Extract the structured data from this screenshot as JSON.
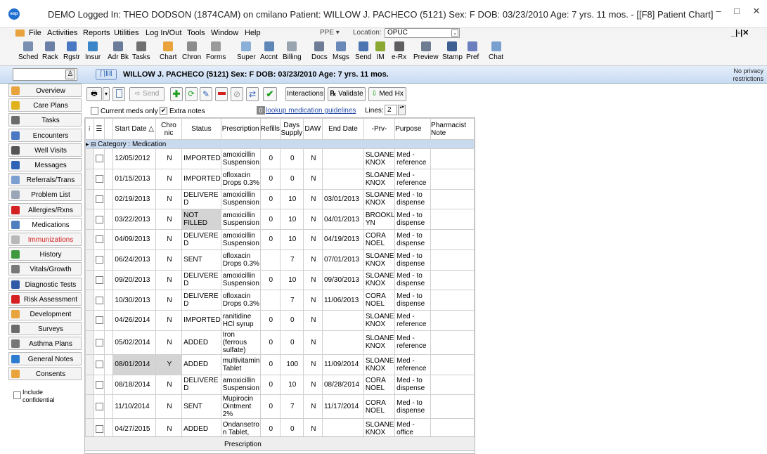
{
  "window": {
    "title": "DEMO Logged In: THEO DODSON (1874CAM) on cmilano  Patient: WILLOW J. PACHECO (5121)  Sex: F  DOB: 03/23/2010  Age: 7 yrs. 11 mos. - [[F8] Patient Chart]",
    "logo": "eop",
    "min": "–",
    "max": "□",
    "close": "✕"
  },
  "menu": {
    "items": [
      "File",
      "Activities",
      "Reports",
      "Utilities",
      "Log In/Out",
      "Tools",
      "Window",
      "Help"
    ],
    "ppe": "PPE ▾",
    "location_label": "Location:",
    "location_value": "OPUC",
    "location_dd": "⌄",
    "mdi": "_|▫|✕"
  },
  "toolbar": [
    {
      "label": "Sched",
      "icon": "calendar-icon",
      "color": "#7a8fb0"
    },
    {
      "label": "Rack",
      "icon": "rack-icon",
      "color": "#6c7fa6"
    },
    {
      "label": "Rgstr",
      "icon": "register-icon",
      "color": "#4a78c2"
    },
    {
      "label": "Insur",
      "icon": "insurance-icon",
      "color": "#3b86c9"
    },
    {
      "label": "Adr Bk",
      "icon": "address-book-icon",
      "color": "#6a7c98"
    },
    {
      "label": "Tasks",
      "icon": "tasks-icon",
      "color": "#707070"
    },
    {
      "label": "Chart",
      "icon": "chart-folder-icon",
      "color": "#e8a33c"
    },
    {
      "label": "Chron",
      "icon": "chronology-icon",
      "color": "#8b8b8b"
    },
    {
      "label": "Forms",
      "icon": "forms-icon",
      "color": "#9a9a9a"
    },
    {
      "label": "Super",
      "icon": "superbill-icon",
      "color": "#8ab0d8"
    },
    {
      "label": "Accnt",
      "icon": "account-icon",
      "color": "#5e86b7"
    },
    {
      "label": "Billing",
      "icon": "billing-icon",
      "color": "#9aa3b0"
    },
    {
      "label": "Docs",
      "icon": "docs-icon",
      "color": "#6e7d95"
    },
    {
      "label": "Msgs",
      "icon": "messages-icon",
      "color": "#6a88b8"
    },
    {
      "label": "Send",
      "icon": "send-icon",
      "color": "#4b74b2"
    },
    {
      "label": "IM",
      "icon": "instant-message-icon",
      "color": "#8aa832"
    },
    {
      "label": "e-Rx",
      "icon": "erx-icon",
      "color": "#5f5f5f"
    },
    {
      "label": "Preview",
      "icon": "preview-icon",
      "color": "#6d7c90"
    },
    {
      "label": "Stamp",
      "icon": "stamp-icon",
      "color": "#3f5f93"
    },
    {
      "label": "Pref",
      "icon": "preferences-icon",
      "color": "#6b7fbf"
    },
    {
      "label": "Chat",
      "icon": "chat-icon",
      "color": "#7aa0d0"
    }
  ],
  "patient": {
    "banner": "WILLOW J. PACHECO (5121)  Sex: F  DOB: 03/23/2010  Age: 7 yrs. 11 mos.",
    "privacy": "No privacy restrictions",
    "icon_text": "⌈⌉ⅡⅡ"
  },
  "sidebar": [
    {
      "label": "Overview",
      "icon": "overview-icon",
      "color": "#e8a33c"
    },
    {
      "label": "Care Plans",
      "icon": "care-plans-icon",
      "color": "#e0b21e"
    },
    {
      "label": "Tasks",
      "icon": "tasks-icon",
      "color": "#6b6b6b"
    },
    {
      "label": "Encounters",
      "icon": "encounters-icon",
      "color": "#4a78c2"
    },
    {
      "label": "Well Visits",
      "icon": "stethoscope-icon",
      "color": "#555555"
    },
    {
      "label": "Messages",
      "icon": "messages-icon",
      "color": "#2e63b5"
    },
    {
      "label": "Referrals/Trans",
      "icon": "referrals-icon",
      "color": "#7a9fd0"
    },
    {
      "label": "Problem List",
      "icon": "problem-list-icon",
      "color": "#9aa6b5"
    },
    {
      "label": "Allergies/Rxns",
      "icon": "allergies-icon",
      "color": "#d42020"
    },
    {
      "label": "Medications",
      "icon": "medications-icon",
      "color": "#4f7fbe"
    },
    {
      "label": "Immunizations",
      "icon": "syringe-icon",
      "color": "#b8b8b8"
    },
    {
      "label": "History",
      "icon": "history-icon",
      "color": "#3f9a3f"
    },
    {
      "label": "Vitals/Growth",
      "icon": "vitals-icon",
      "color": "#777777"
    },
    {
      "label": "Diagnostic Tests",
      "icon": "diagnostic-icon",
      "color": "#2e5aa8"
    },
    {
      "label": "Risk Assessment",
      "icon": "risk-icon",
      "color": "#d42020"
    },
    {
      "label": "Development",
      "icon": "development-icon",
      "color": "#e8a33c"
    },
    {
      "label": "Surveys",
      "icon": "surveys-icon",
      "color": "#6b6b6b"
    },
    {
      "label": "Asthma Plans",
      "icon": "asthma-icon",
      "color": "#777777"
    },
    {
      "label": "General Notes",
      "icon": "general-notes-icon",
      "color": "#2c7bd0"
    },
    {
      "label": "Consents",
      "icon": "consents-icon",
      "color": "#e8a33c"
    }
  ],
  "include_confidential": "Include confidential",
  "medtb": {
    "send": "Send",
    "interactions": "Interactions",
    "validate": "Validate",
    "medhx": "Med Hx",
    "print_glyph": "🖶",
    "add_glyph": "✚",
    "dd": "▾",
    "rx": "℞",
    "check": "✔"
  },
  "opts": {
    "current_meds": "Current meds only",
    "extra_notes": "Extra notes",
    "guide_count": "0",
    "guide_link": "lookup medication guidelines",
    "lines_label": "Lines:",
    "lines_value": "2",
    "check": "✔",
    "spin": "▴▾"
  },
  "grid": {
    "columns": [
      "",
      "",
      "",
      "Start Date △",
      "Chro nic",
      "Status",
      "Prescription",
      "Refills",
      "Days Supply",
      "DAW",
      "End Date",
      "-Prv-",
      "Purpose",
      "Pharmacist Note"
    ],
    "category": "Category : Medication",
    "rows": [
      [
        "12/05/2012",
        "N",
        "IMPORTED",
        "amoxicillin Suspension",
        "0",
        "0",
        "N",
        "",
        "SLOANE KNOX",
        "Med - reference",
        ""
      ],
      [
        "01/15/2013",
        "N",
        "IMPORTED",
        "ofloxacin Drops 0.3%",
        "0",
        "0",
        "N",
        "",
        "SLOANE KNOX",
        "Med - reference",
        ""
      ],
      [
        "02/19/2013",
        "N",
        "DELIVERE D",
        "amoxicillin Suspension",
        "0",
        "10",
        "N",
        "03/01/2013",
        "SLOANE KNOX",
        "Med - to dispense",
        ""
      ],
      [
        "03/22/2013",
        "N",
        "NOT FILLED",
        "amoxicillin Suspension",
        "0",
        "10",
        "N",
        "04/01/2013",
        "BROOKL YN",
        "Med - to dispense",
        ""
      ],
      [
        "04/09/2013",
        "N",
        "DELIVERE D",
        "amoxicillin Suspension",
        "0",
        "10",
        "N",
        "04/19/2013",
        "CORA NOEL",
        "Med - to dispense",
        ""
      ],
      [
        "06/24/2013",
        "N",
        "SENT",
        "ofloxacin Drops 0.3%",
        "",
        "7",
        "N",
        "07/01/2013",
        "SLOANE KNOX",
        "Med - to dispense",
        ""
      ],
      [
        "09/20/2013",
        "N",
        "DELIVERE D",
        "amoxicillin Suspension",
        "0",
        "10",
        "N",
        "09/30/2013",
        "SLOANE KNOX",
        "Med - to dispense",
        ""
      ],
      [
        "10/30/2013",
        "N",
        "DELIVERE D",
        "ofloxacin Drops 0.3%",
        "",
        "7",
        "N",
        "11/06/2013",
        "CORA NOEL",
        "Med - to dispense",
        ""
      ],
      [
        "04/26/2014",
        "N",
        "IMPORTED",
        "ranitidine HCl syrup",
        "0",
        "0",
        "N",
        "",
        "SLOANE KNOX",
        "Med - reference",
        ""
      ],
      [
        "05/02/2014",
        "N",
        "ADDED",
        "Iron (ferrous sulfate)",
        "0",
        "0",
        "N",
        "",
        "SLOANE KNOX",
        "Med - reference",
        ""
      ],
      [
        "08/01/2014",
        "Y",
        "ADDED",
        "multivitamin Tablet",
        "0",
        "100",
        "N",
        "11/09/2014",
        "SLOANE KNOX",
        "Med - reference",
        ""
      ],
      [
        "08/18/2014",
        "N",
        "DELIVERE D",
        "amoxicillin Suspension",
        "0",
        "10",
        "N",
        "08/28/2014",
        "CORA NOEL",
        "Med - to dispense",
        ""
      ],
      [
        "11/10/2014",
        "N",
        "SENT",
        "Mupirocin Ointment 2%",
        "0",
        "7",
        "N",
        "11/17/2014",
        "CORA NOEL",
        "Med - to dispense",
        ""
      ],
      [
        "04/27/2015",
        "N",
        "ADDED",
        "Ondansetro n Tablet,",
        "0",
        "0",
        "N",
        "",
        "SLOANE KNOX",
        "Med - office",
        ""
      ]
    ],
    "footer": "Prescription"
  },
  "colors": {
    "accent": "#1e6fd0",
    "banner_bg": "#c9dbf2",
    "category_bg": "#c9d9ee",
    "highlight": "#d4d4d4"
  }
}
